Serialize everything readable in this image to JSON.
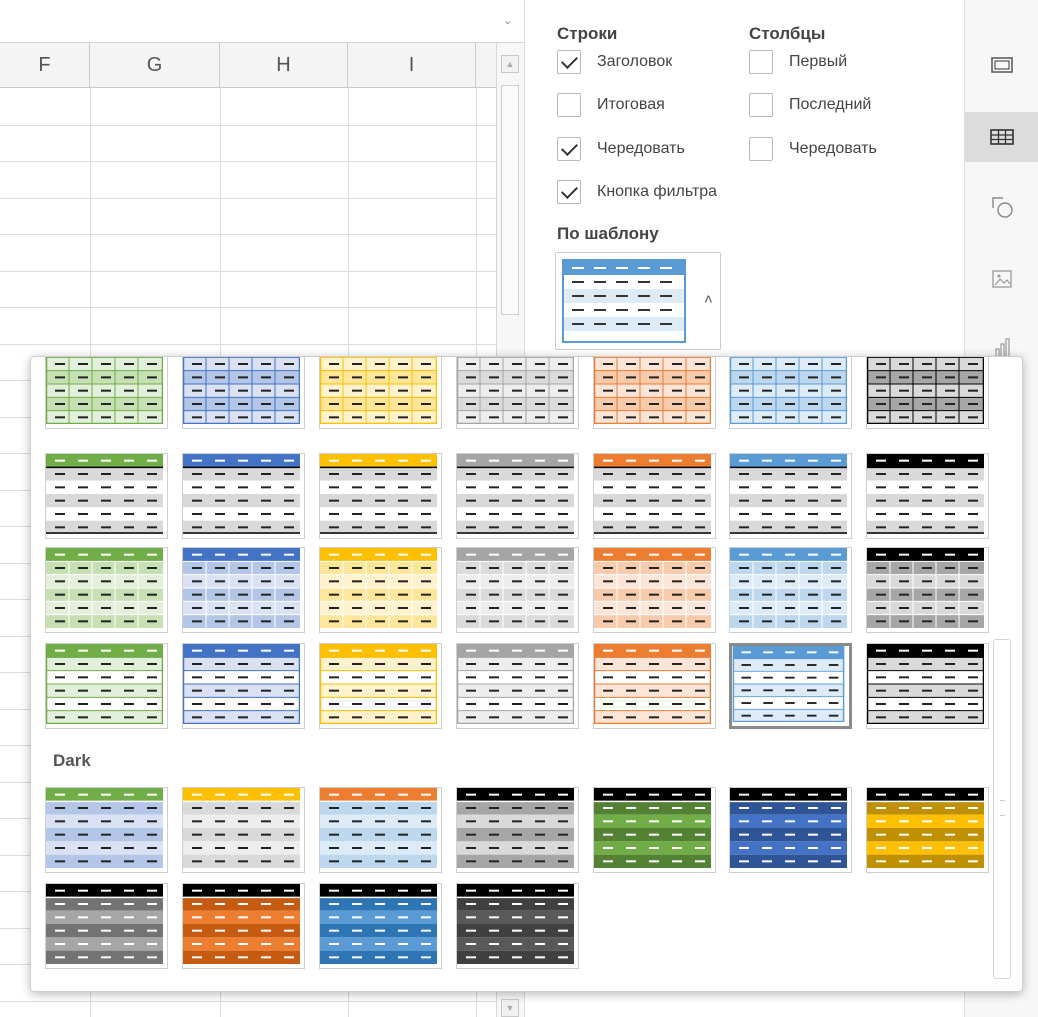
{
  "sheet": {
    "columns": [
      "F",
      "G",
      "H",
      "I"
    ],
    "formula_expand": "⌄"
  },
  "panel": {
    "rows_title": "Строки",
    "cols_title": "Столбцы",
    "rows": [
      {
        "label": "Заголовок",
        "checked": true
      },
      {
        "label": "Итоговая",
        "checked": false
      },
      {
        "label": "Чередовать",
        "checked": true
      },
      {
        "label": "Кнопка фильтра",
        "checked": true
      }
    ],
    "cols": [
      {
        "label": "Первый",
        "checked": false
      },
      {
        "label": "Последний",
        "checked": false
      },
      {
        "label": "Чередовать",
        "checked": false
      }
    ],
    "template_title": "По шаблону",
    "template_caret": "˄"
  },
  "toolbar": {
    "icons": [
      "cell-settings-icon",
      "table-settings-icon",
      "shape-settings-icon",
      "image-settings-icon",
      "chart-settings-icon"
    ],
    "active": "table-settings-icon"
  },
  "templates": {
    "dark_label": "Dark",
    "colors": {
      "green": [
        "#70ad47",
        "#c6e0b4",
        "#e2efda"
      ],
      "blue": [
        "#4472c4",
        "#b4c6e7",
        "#d9e1f2"
      ],
      "yellow": [
        "#ffc000",
        "#ffe699",
        "#fff2cc"
      ],
      "gray": [
        "#a5a5a5",
        "#dbdbdb",
        "#ededed"
      ],
      "orange": [
        "#ed7d31",
        "#f8cbad",
        "#fce4d6"
      ],
      "lightblue": [
        "#5b9bd5",
        "#bdd7ee",
        "#ddebf7"
      ],
      "black": [
        "#000000",
        "#a6a6a6",
        "#d9d9d9"
      ]
    },
    "medium_rows": [
      {
        "style": "grid",
        "items": [
          "green",
          "blue",
          "yellow",
          "gray",
          "orange",
          "lightblue",
          "black"
        ]
      },
      {
        "style": "header-line",
        "items": [
          "green",
          "blue",
          "yellow",
          "gray",
          "orange",
          "lightblue",
          "black"
        ]
      },
      {
        "style": "banded",
        "items": [
          "green",
          "blue",
          "yellow",
          "gray",
          "orange",
          "lightblue",
          "black"
        ]
      },
      {
        "style": "light",
        "items": [
          "green",
          "blue",
          "yellow",
          "gray",
          "orange",
          "lightblue",
          "black"
        ]
      }
    ],
    "selected": {
      "row": 3,
      "col": 5
    },
    "dark_rows": [
      {
        "items": [
          {
            "header": "#70ad47",
            "band1": "#b4c6e7",
            "band2": "#d9e1f2"
          },
          {
            "header": "#ffc000",
            "band1": "#d9d9d9",
            "band2": "#ededed"
          },
          {
            "header": "#ed7d31",
            "band1": "#bdd7ee",
            "band2": "#ddebf7"
          },
          {
            "header": "#000000",
            "band1": "#a6a6a6",
            "band2": "#d9d9d9"
          },
          {
            "header": "#000000",
            "band1": "#548235",
            "band2": "#70ad47"
          },
          {
            "header": "#000000",
            "band1": "#2f5597",
            "band2": "#4472c4"
          },
          {
            "header": "#000000",
            "band1": "#bf9000",
            "band2": "#ffc000"
          }
        ]
      },
      {
        "items": [
          {
            "header": "#000000",
            "band1": "#737373",
            "band2": "#a6a6a6"
          },
          {
            "header": "#000000",
            "band1": "#c55a11",
            "band2": "#ed7d31"
          },
          {
            "header": "#000000",
            "band1": "#2e75b6",
            "band2": "#5b9bd5"
          },
          {
            "header": "#000000",
            "band1": "#404040",
            "band2": "#595959"
          }
        ]
      }
    ]
  }
}
